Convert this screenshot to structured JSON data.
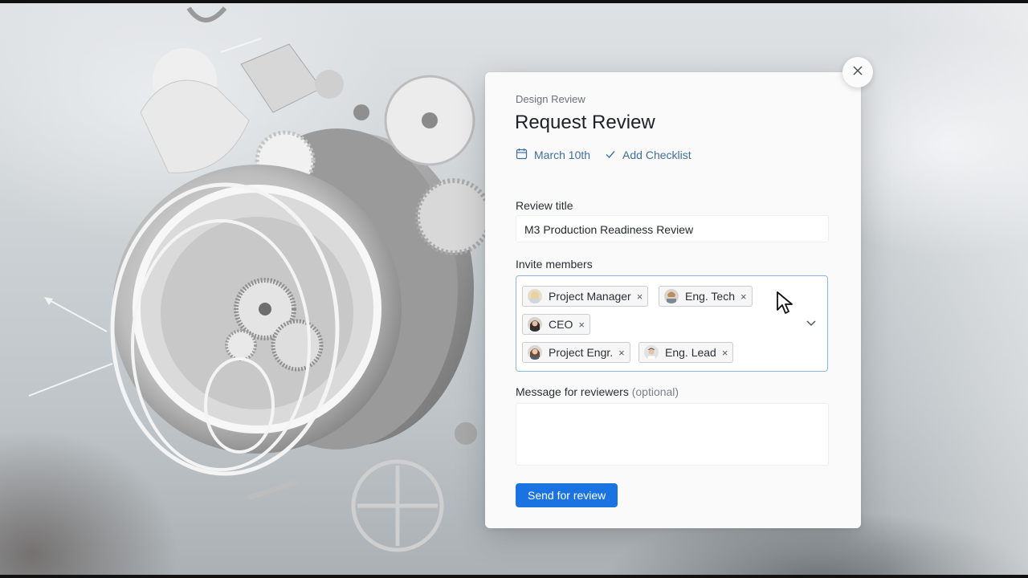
{
  "dialog": {
    "eyebrow": "Design Review",
    "title": "Request Review",
    "date_label": "March 10th",
    "checklist_label": "Add Checklist",
    "review_title_label": "Review title",
    "review_title_value": "M3 Production Readiness Review",
    "invite_label": "Invite members",
    "members": [
      {
        "name": "Project Manager",
        "remove": "×"
      },
      {
        "name": "Eng. Tech",
        "remove": "×"
      },
      {
        "name": "CEO",
        "remove": "×"
      },
      {
        "name": "Project Engr.",
        "remove": "×"
      },
      {
        "name": "Eng. Lead",
        "remove": "×"
      }
    ],
    "message_label": "Message for reviewers",
    "message_optional": "(optional)",
    "message_value": "",
    "send_label": "Send for review"
  },
  "icons": {
    "close": "close-icon",
    "calendar": "calendar-icon",
    "check": "check-icon",
    "chevron": "chevron-down-icon",
    "cursor": "mouse-pointer-icon"
  },
  "colors": {
    "accent": "#1a73e0",
    "link": "#3f6e9c",
    "focus_border": "#8bb5e6"
  }
}
